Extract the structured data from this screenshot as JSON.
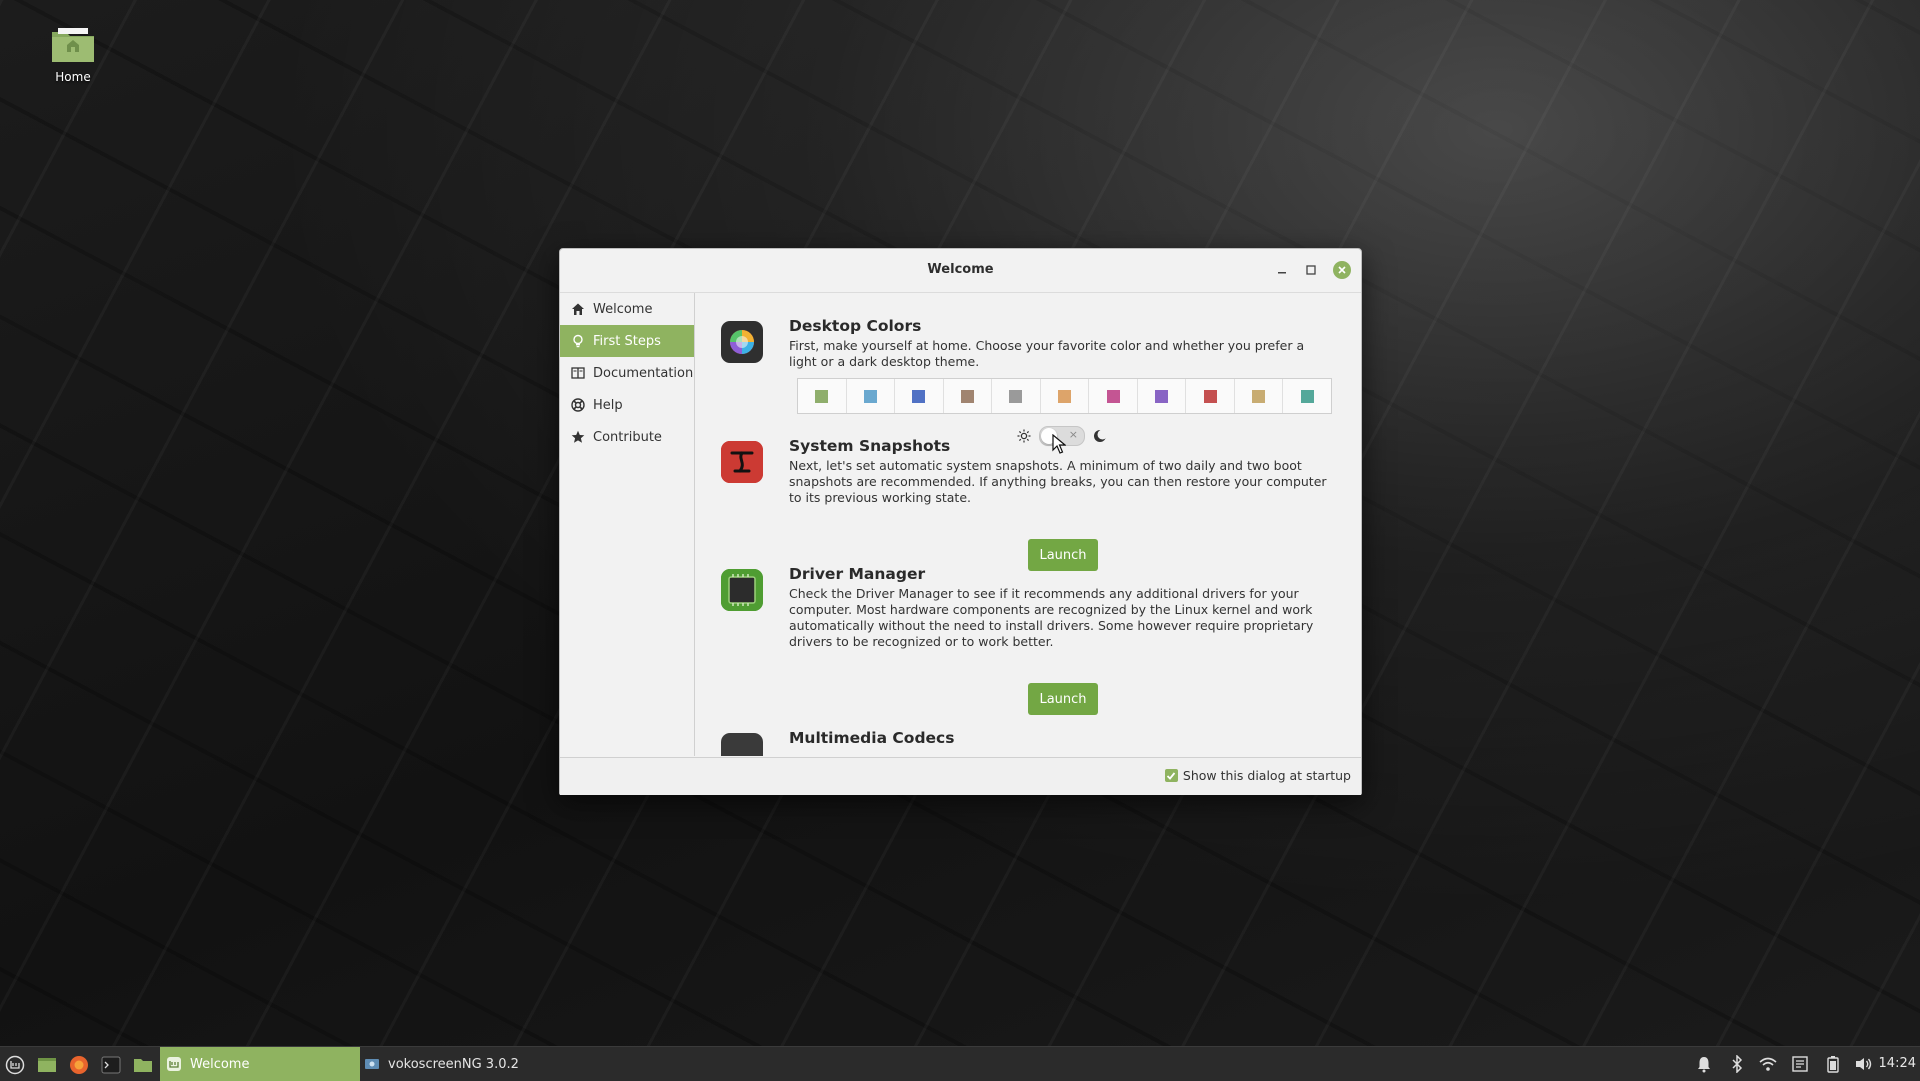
{
  "desktop": {
    "icons": [
      {
        "label": "Home",
        "icon": "home-folder-icon"
      }
    ]
  },
  "window": {
    "title": "Welcome",
    "controls": [
      "minimize-icon",
      "maximize-icon",
      "close-icon"
    ],
    "sidebar": {
      "items": [
        {
          "label": "Welcome",
          "icon": "home-icon",
          "active": false
        },
        {
          "label": "First Steps",
          "icon": "lightbulb-icon",
          "active": true
        },
        {
          "label": "Documentation",
          "icon": "book-icon",
          "active": false
        },
        {
          "label": "Help",
          "icon": "lifebuoy-icon",
          "active": false
        },
        {
          "label": "Contribute",
          "icon": "star-icon",
          "active": false
        }
      ]
    },
    "sections": [
      {
        "title": "Desktop Colors",
        "icon": "color-wheel-icon",
        "text": "First, make yourself at home. Choose your favorite color and whether you prefer a light or a dark desktop theme."
      },
      {
        "title": "System Snapshots",
        "icon": "timeshift-icon",
        "text": "Next, let's set automatic system snapshots. A minimum of two daily and two boot snapshots are recommended. If anything breaks, you can then restore your computer to its previous working state.",
        "button": "Launch"
      },
      {
        "title": "Driver Manager",
        "icon": "driver-chip-icon",
        "text": "Check the Driver Manager to see if it recommends any additional drivers for your computer. Most hardware components are recognized by the Linux kernel and work automatically without the need to install drivers. Some however require proprietary drivers to be recognized or to work better.",
        "button": "Launch"
      },
      {
        "title": "Multimedia Codecs",
        "icon": "multimedia-icon"
      }
    ],
    "colors": [
      "#8fae6c",
      "#6aa8cf",
      "#5071c4",
      "#a08470",
      "#9a9a9a",
      "#dda46a",
      "#c45593",
      "#8864c4",
      "#c45050",
      "#c8ac72",
      "#54a89a"
    ],
    "theme_toggle": {
      "light_icon": "sun-icon",
      "dark_icon": "moon-icon",
      "dark": false
    },
    "footer": {
      "checkbox_label": "Show this dialog at startup",
      "checked": true
    }
  },
  "taskbar": {
    "launchers": [
      "menu-icon",
      "show-desktop-icon",
      "firefox-icon",
      "terminal-icon",
      "files-icon"
    ],
    "tasks": [
      {
        "label": "Welcome",
        "active": true,
        "icon": "mint-welcome-icon"
      },
      {
        "label": "vokoscreenNG 3.0.2",
        "active": false,
        "icon": "vokoscreen-icon"
      }
    ],
    "tray": [
      "notifications-icon",
      "bluetooth-icon",
      "wifi-icon",
      "update-manager-icon",
      "battery-icon",
      "volume-icon"
    ],
    "clock": "14:24"
  }
}
